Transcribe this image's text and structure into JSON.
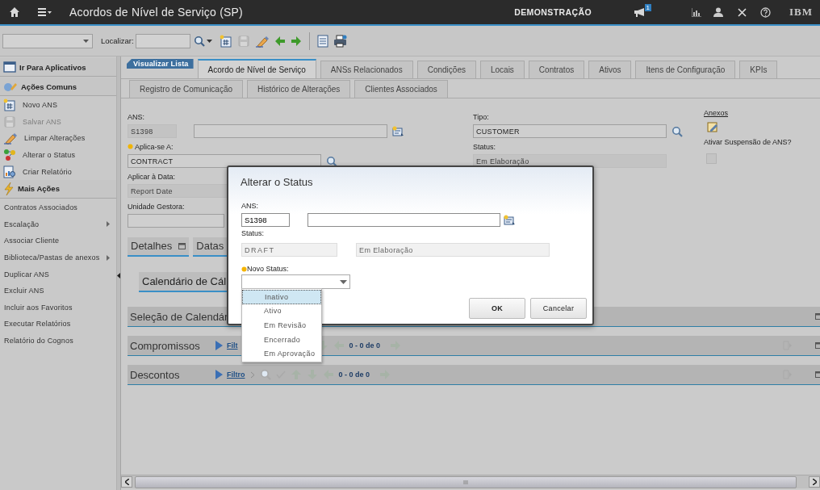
{
  "header": {
    "title": "Acordos de Nível de Serviço (SP)",
    "user": "DEMONSTRAÇÃO",
    "notification_count": "1",
    "brand": "IBM"
  },
  "toolbar": {
    "search_label": "Localizar:"
  },
  "sidebar": {
    "sections": [
      {
        "title": "Ir Para Aplicativos"
      },
      {
        "title": "Ações Comuns",
        "items": [
          {
            "label": "Novo ANS",
            "disabled": false
          },
          {
            "label": "Salvar ANS",
            "disabled": true
          },
          {
            "label": "Limpar Alterações",
            "disabled": false
          },
          {
            "label": "Alterar o Status",
            "disabled": false
          },
          {
            "label": "Criar Relatório",
            "disabled": false
          }
        ]
      },
      {
        "title": "Mais Ações",
        "items": [
          {
            "label": "Contratos Associados",
            "submenu": false
          },
          {
            "label": "Escalação",
            "submenu": true
          },
          {
            "label": "Associar Cliente",
            "submenu": false
          },
          {
            "label": "Biblioteca/Pastas de anexos",
            "submenu": true
          },
          {
            "label": "Duplicar ANS",
            "submenu": false
          },
          {
            "label": "Excluir ANS",
            "submenu": false
          },
          {
            "label": "Incluir aos Favoritos",
            "submenu": false
          },
          {
            "label": "Executar Relatórios",
            "submenu": false
          },
          {
            "label": "Relatório do Cognos",
            "submenu": false
          }
        ]
      }
    ]
  },
  "view_list": "Visualizar Lista",
  "tab_rows": [
    [
      {
        "label": "Acordo de Nível de Serviço",
        "selected": true
      },
      {
        "label": "ANSs Relacionados",
        "selected": false
      },
      {
        "label": "Condições",
        "selected": false
      },
      {
        "label": "Locais",
        "selected": false
      },
      {
        "label": "Contratos",
        "selected": false
      },
      {
        "label": "Ativos",
        "selected": false
      },
      {
        "label": "Itens de Configuração",
        "selected": false
      },
      {
        "label": "KPIs",
        "selected": false
      }
    ],
    [
      {
        "label": "Registro de Comunicação",
        "selected": false
      },
      {
        "label": "Histórico de Alterações",
        "selected": false
      },
      {
        "label": "Clientes Associados",
        "selected": false
      }
    ]
  ],
  "form": {
    "ans": {
      "label": "ANS:",
      "code": "S1398"
    },
    "applies_to": {
      "label": "Aplica-se A:",
      "required": true,
      "value": "CONTRACT"
    },
    "apply_date": {
      "label": "Aplicar à Data:",
      "value": "Report Date",
      "readonly": true
    },
    "managing_unit": {
      "label": "Unidade Gestora:"
    },
    "type": {
      "label": "Tipo:",
      "value": "CUSTOMER"
    },
    "status": {
      "label": "Status:",
      "value": "Em Elaboração",
      "readonly": true
    },
    "attachments": {
      "label": "Anexos"
    },
    "suspend": {
      "label": "Ativar Suspensão de ANS?",
      "checked": false
    }
  },
  "section_tabs": [
    "Detalhes",
    "Datas"
  ],
  "subsection": "Calendário de Cál",
  "panels": [
    {
      "kind": "plain",
      "title": "Seleção de Calendár"
    },
    {
      "kind": "table",
      "title": "Compromissos",
      "filter": "Filt",
      "count": "0 - 0 de 0"
    },
    {
      "kind": "table",
      "title": "Descontos",
      "filter": "Filtro",
      "count": "0 - 0 de 0"
    }
  ],
  "dialog": {
    "title": "Alterar o Status",
    "ans_label": "ANS:",
    "ans_code": "S1398",
    "status_label": "Status:",
    "status_code": "DRAFT",
    "status_desc": "Em Elaboração",
    "new_status_label": "Novo Status:",
    "new_status_required": true,
    "options": [
      {
        "label": "Inativo",
        "selected": true
      },
      {
        "label": "Ativo",
        "selected": false
      },
      {
        "label": "Em Revisão",
        "selected": false
      },
      {
        "label": "Encerrado",
        "selected": false
      },
      {
        "label": "Em Aprovação",
        "selected": false
      }
    ],
    "buttons": [
      {
        "label": "OK",
        "kind": "primary"
      },
      {
        "label": "Cancelar",
        "kind": "secondary"
      }
    ]
  }
}
